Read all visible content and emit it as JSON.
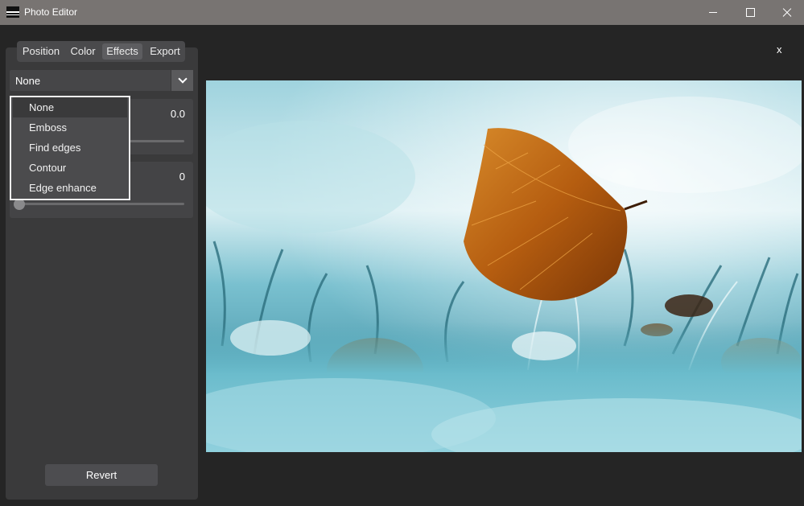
{
  "window": {
    "title": "Photo Editor"
  },
  "tabs": [
    "Position",
    "Color",
    "Effects",
    "Export"
  ],
  "active_tab": "Effects",
  "effect_select": {
    "value": "None"
  },
  "dropdown_options": [
    "None",
    "Emboss",
    "Find edges",
    "Contour",
    "Edge enhance"
  ],
  "sliders": [
    {
      "value": "0.0",
      "level": 0.0
    },
    {
      "value": "0",
      "level": 0.0
    }
  ],
  "buttons": {
    "revert": "Revert",
    "close_preview": "x"
  },
  "icons": {
    "app": "photo-editor-app-icon",
    "minimize": "minimize-icon",
    "maximize": "maximize-icon",
    "close": "close-icon",
    "dropdown": "chevron-down-icon"
  },
  "colors": {
    "titlebar": "#787472",
    "background": "#252525",
    "panel": "#3a3a3b",
    "highlight": "#f0f0f0"
  },
  "image": {
    "subject": "leaf-in-frosty-grass"
  }
}
